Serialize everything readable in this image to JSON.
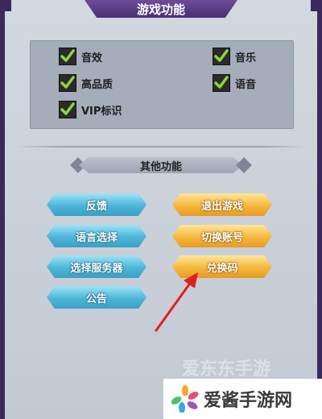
{
  "header": {
    "title": "游戏功能"
  },
  "settings": [
    {
      "label": "音效",
      "checked": true
    },
    {
      "label": "音乐",
      "checked": true
    },
    {
      "label": "高品质",
      "checked": true
    },
    {
      "label": "语音",
      "checked": true
    },
    {
      "label": "VIP标识",
      "checked": true
    }
  ],
  "other": {
    "title": "其他功能",
    "buttons": {
      "feedback": "反馈",
      "language": "语言选择",
      "server": "选择服务器",
      "notice": "公告",
      "logout": "退出游戏",
      "switch_account": "切换账号",
      "redeem": "兑换码"
    }
  },
  "watermark": {
    "faint": "爱东东手游",
    "brand": "爱酱手游网"
  },
  "colors": {
    "accent_blue": "#4db6d8",
    "accent_gold": "#f5b73c",
    "frame": "#3a2a5c",
    "arrow": "#e02020"
  }
}
